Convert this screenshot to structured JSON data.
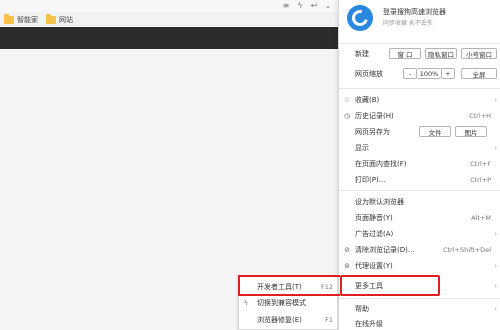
{
  "toolbar": {
    "icons": [
      "list-icon",
      "lightning-icon",
      "arrow-back-icon",
      "chevron-down-icon"
    ],
    "glyphs": [
      "≡",
      "ϟ",
      "↩",
      "⌄"
    ]
  },
  "bookmarks": [
    {
      "label": "智能家",
      "icon": "folder-icon"
    },
    {
      "label": "网站",
      "icon": "folder-icon"
    }
  ],
  "account": {
    "title": "登录搜狗高速浏览器",
    "subtitle": "同步收藏 永不丢失"
  },
  "menu": {
    "new_label": "新建",
    "new_window": "窗 口",
    "private_window": "隐私窗口",
    "small_window": "小号窗口",
    "zoom_label": "网页缩放",
    "zoom_minus": "-",
    "zoom_value": "100%",
    "zoom_plus": "+",
    "fullscreen": "全屏",
    "items": [
      {
        "icon": "☆",
        "label": "收藏(B)",
        "shortcut": "",
        "arrow": "›"
      },
      {
        "icon": "◷",
        "label": "历史记录(H)",
        "shortcut": "Ctrl+H",
        "arrow": ""
      },
      {
        "icon": "",
        "label": "网页另存为",
        "shortcut": "",
        "arrow": ""
      },
      {
        "icon": "",
        "label": "显示",
        "shortcut": "",
        "arrow": "›"
      },
      {
        "icon": "",
        "label": "在页面内查找(F)",
        "shortcut": "Ctrl+F",
        "arrow": ""
      },
      {
        "icon": "",
        "label": "打印(P)...",
        "shortcut": "Ctrl+P",
        "arrow": ""
      },
      {
        "icon": "",
        "label": "设为默认浏览器",
        "shortcut": "",
        "arrow": ""
      },
      {
        "icon": "",
        "label": "页面静音(Y)",
        "shortcut": "Alt+M",
        "arrow": ""
      },
      {
        "icon": "",
        "label": "广告过滤(A)",
        "shortcut": "",
        "arrow": "›"
      },
      {
        "icon": "⊘",
        "label": "清除浏览记录(D)...",
        "shortcut": "Ctrl+Shift+Del",
        "arrow": ""
      },
      {
        "icon": "⊚",
        "label": "代理设置(Y)",
        "shortcut": "",
        "arrow": "›"
      },
      {
        "icon": "",
        "label": "更多工具",
        "shortcut": "",
        "arrow": "›"
      },
      {
        "icon": "",
        "label": "帮助",
        "shortcut": "",
        "arrow": "›"
      },
      {
        "icon": "",
        "label": "在线升级",
        "shortcut": "",
        "arrow": ""
      }
    ],
    "save_as_buttons": [
      "文件",
      "图片"
    ]
  },
  "submenu": {
    "items": [
      {
        "icon": "",
        "label": "开发者工具(T)",
        "shortcut": "F12"
      },
      {
        "icon": "ϟ",
        "label": "切换到兼容模式",
        "shortcut": ""
      },
      {
        "icon": "",
        "label": "浏览器修复(E)",
        "shortcut": "F1"
      }
    ]
  },
  "colors": {
    "highlight": "#e02020",
    "logo": "#2a88e0",
    "folder": "#f5c24a",
    "dark_strip": "#2b2b2b"
  }
}
